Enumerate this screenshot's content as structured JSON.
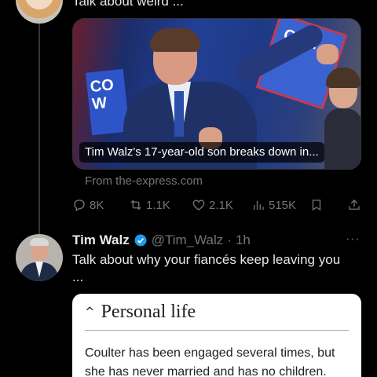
{
  "previous_post": {
    "text": "Talk about weird ...",
    "link_card": {
      "headline": "Tim Walz's 17-year-old son breaks down in...",
      "sign_left": "CO\nW",
      "sign_right": "COA"
    },
    "source": "From the-express.com",
    "actions": {
      "replies": "8K",
      "reposts": "1.1K",
      "likes": "2.1K",
      "views": "515K"
    }
  },
  "reply_post": {
    "author_name": "Tim Walz",
    "handle": "@Tim_Walz",
    "separator": "·",
    "time": "1h",
    "more": "···",
    "text": "Talk about why your fiancés keep leaving you ...",
    "wiki_card": {
      "section_title": "Personal life",
      "chevron": "^",
      "text": "Coulter has been engaged several times, but she has never married and has no children."
    }
  },
  "colors": {
    "background": "#000000",
    "text": "#e7e9ea",
    "muted": "#71767b",
    "verified": "#1d9bf0"
  }
}
